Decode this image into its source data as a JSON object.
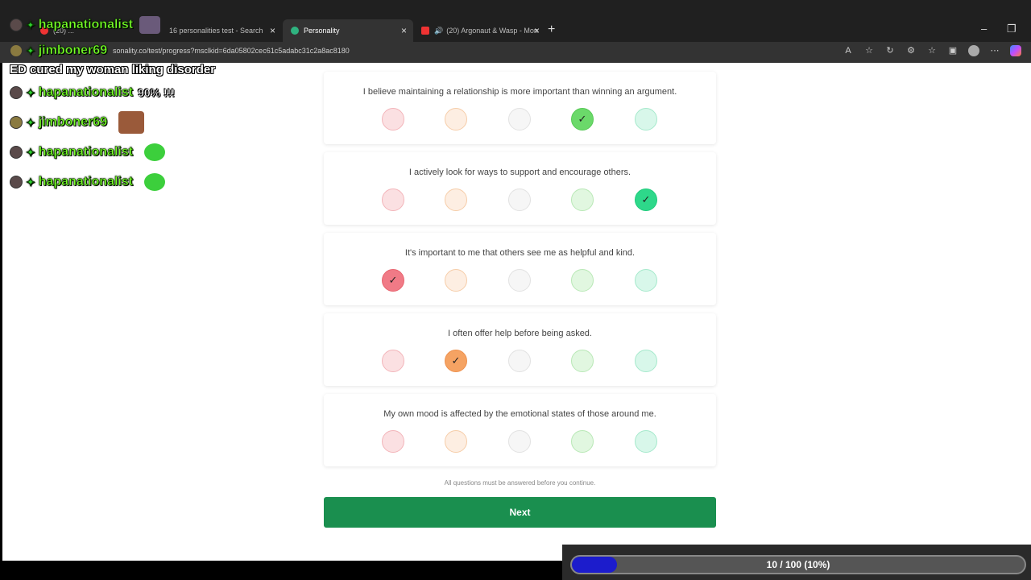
{
  "browser": {
    "tabs": [
      {
        "label": "(20) ...",
        "active": false
      },
      {
        "label": "16 personalities test - Search",
        "active": false
      },
      {
        "label": "Personality",
        "active": true
      },
      {
        "label": "(20) Argonaut & Wasp - Mon",
        "active": false
      }
    ],
    "new_tab": "+",
    "url": "sonality.co/test/progress?msclkid=6da05802cec61c5adabc31c2a8ac8180"
  },
  "questions": [
    {
      "text": "I believe maintaining a relationship is more important than winning an argument.",
      "selected": 4
    },
    {
      "text": "I actively look for ways to support and encourage others.",
      "selected": 5
    },
    {
      "text": "It's important to me that others see me as helpful and kind.",
      "selected": 1
    },
    {
      "text": "I often offer help before being asked.",
      "selected": 2
    },
    {
      "text": "My own mood is affected by the emotional states of those around me.",
      "selected": 0
    }
  ],
  "check_glyph": "✓",
  "note": "All questions must be answered before you continue.",
  "next_label": "Next",
  "overlay": {
    "top_user": "hapanationalist",
    "second_user": "jimboner69",
    "headline": "ED cured my woman liking disorder",
    "chat": [
      {
        "user": "hapanationalist",
        "message": "90% !!!"
      },
      {
        "user": "jimboner69",
        "message": ""
      },
      {
        "user": "hapanationalist",
        "message": ""
      },
      {
        "user": "hapanationalist",
        "message": ""
      }
    ]
  },
  "progress": {
    "label": "10 / 100 (10%)",
    "fraction": 0.1,
    "fill_color": "#1c1ccc"
  }
}
